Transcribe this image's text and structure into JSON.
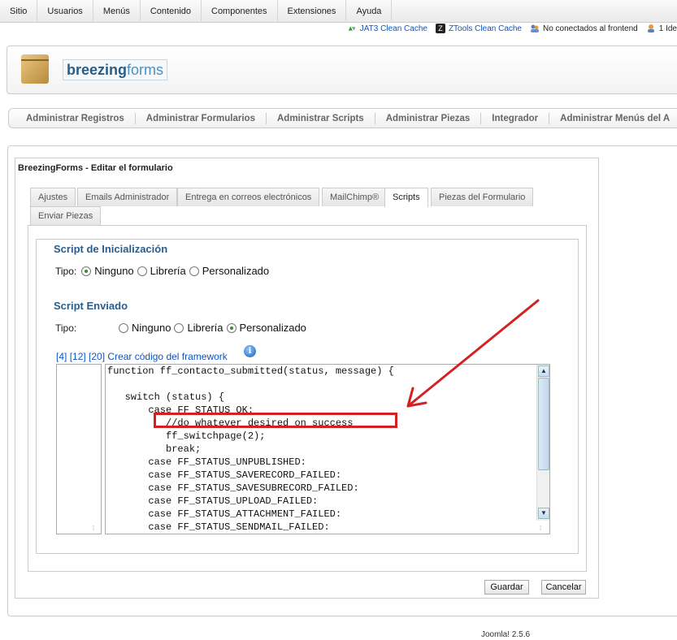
{
  "topmenu": [
    "Sitio",
    "Usuarios",
    "Menús",
    "Contenido",
    "Componentes",
    "Extensiones",
    "Ayuda"
  ],
  "status": {
    "jat3": "JAT3 Clean Cache",
    "ztools": "ZTools Clean Cache",
    "frontend": "No conectados al frontend",
    "ide": "1 Ide"
  },
  "brand": {
    "part1": "breezing",
    "part2": "forms"
  },
  "submenu": [
    "Administrar Registros",
    "Administrar Formularios",
    "Administrar Scripts",
    "Administrar Piezas",
    "Integrador",
    "Administrar Menús del A"
  ],
  "panel": {
    "title": "BreezingForms - Editar el formulario"
  },
  "tabs": [
    "Ajustes",
    "Emails Administrador",
    "Entrega en correos electrónicos",
    "MailChimp®",
    "Scripts",
    "Piezas del Formulario",
    "Enviar Piezas"
  ],
  "init_script": {
    "title": "Script de Inicialización",
    "tipo_label": "Tipo:",
    "options": [
      "Ninguno",
      "Librería",
      "Personalizado"
    ],
    "selected": "Ninguno"
  },
  "submit_script": {
    "title": "Script Enviado",
    "tipo_label": "Tipo:",
    "options": [
      "Ninguno",
      "Librería",
      "Personalizado"
    ],
    "selected": "Personalizado"
  },
  "links": {
    "l4": "[4]",
    "l12": "[12]",
    "l20": "[20]",
    "create": "Crear código del framework"
  },
  "info_icon": "i",
  "code_lines": [
    "function ff_contacto_submitted(status, message) {",
    "",
    "   switch (status) {",
    "       case FF_STATUS_OK:",
    "          //do whatever desired on success",
    "          ff_switchpage(2);",
    "          break;",
    "       case FF_STATUS_UNPUBLISHED:",
    "       case FF_STATUS_SAVERECORD_FAILED:",
    "       case FF_STATUS_SAVESUBRECORD_FAILED:",
    "       case FF_STATUS_UPLOAD_FAILED:",
    "       case FF_STATUS_ATTACHMENT_FAILED:",
    "       case FF_STATUS_SENDMAIL_FAILED:"
  ],
  "buttons": {
    "save": "Guardar",
    "cancel": "Cancelar"
  },
  "footer": "Joomla! 2.5.6",
  "colors": {
    "annotation_red": "#d42020",
    "link_blue": "#0b55c4",
    "title_blue": "#2c5d8a"
  }
}
